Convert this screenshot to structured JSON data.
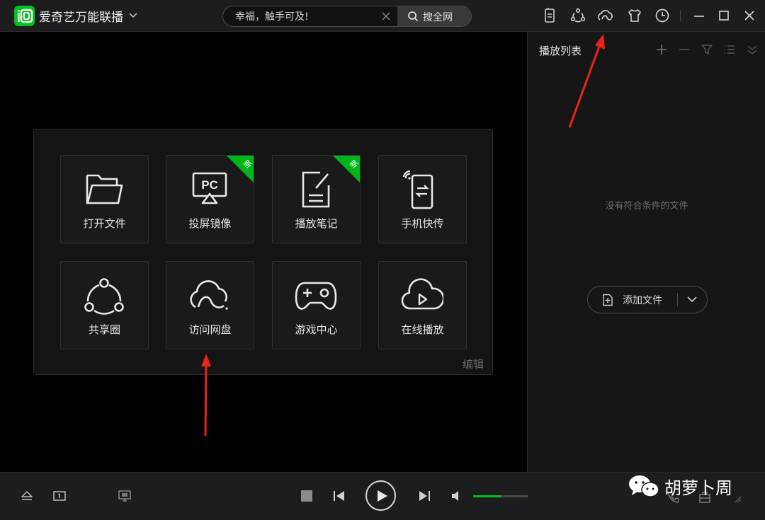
{
  "app": {
    "title": "爱奇艺万能联播",
    "brand_color": "#00c21c"
  },
  "search": {
    "value": "幸福，触手可及!",
    "button_label": "搜全网"
  },
  "toolbar": {
    "icons": [
      "phone-sync-icon",
      "share-icon",
      "cloud-icon",
      "skin-icon",
      "history-icon"
    ],
    "window_controls": [
      "minimize-icon",
      "maximize-icon",
      "close-icon"
    ]
  },
  "panel": {
    "tiles": [
      {
        "label": "打开文件",
        "icon": "folder-icon",
        "new": false
      },
      {
        "label": "投屏镜像",
        "icon": "pc-cast-icon",
        "new": true
      },
      {
        "label": "播放笔记",
        "icon": "note-icon",
        "new": true
      },
      {
        "label": "手机快传",
        "icon": "phone-transfer-icon",
        "new": false
      },
      {
        "label": "共享圈",
        "icon": "share-circle-icon",
        "new": false
      },
      {
        "label": "访问网盘",
        "icon": "cloud-drive-icon",
        "new": false
      },
      {
        "label": "游戏中心",
        "icon": "gamepad-icon",
        "new": false
      },
      {
        "label": "在线播放",
        "icon": "cloud-play-icon",
        "new": false
      }
    ],
    "new_badge": "新",
    "edit_label": "编辑"
  },
  "playlist": {
    "title": "播放列表",
    "empty_text": "没有符合条件的文件",
    "add_file_label": "添加文件"
  },
  "controls": {
    "volume_level": 0.5
  },
  "watermark": {
    "text": "胡萝卜周"
  },
  "annotation_color": "#e8241c"
}
